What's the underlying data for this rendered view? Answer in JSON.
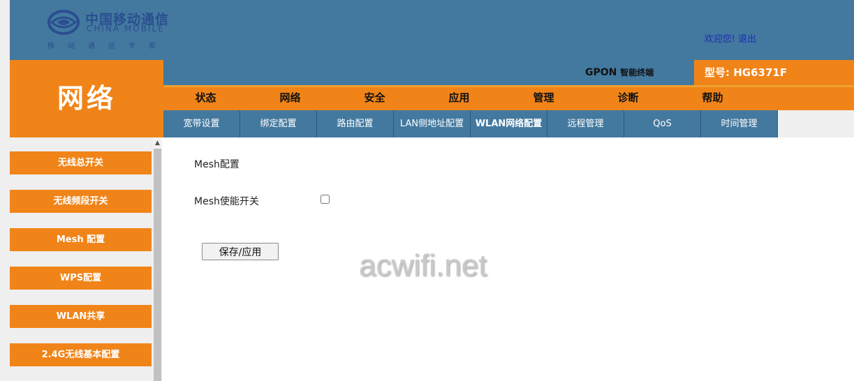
{
  "header": {
    "logo_cn": "中国移动通信",
    "logo_en": "CHINA MOBILE",
    "logo_slogan": "移动通信专家",
    "welcome_text": "欢迎您!",
    "logout_label": "退出"
  },
  "section_title": "网络",
  "device": {
    "gpon_label": "GPON",
    "terminal_label": "智能终端",
    "model_label": "型号: HG6371F"
  },
  "main_nav": [
    "状态",
    "网络",
    "安全",
    "应用",
    "管理",
    "诊断",
    "帮助"
  ],
  "sub_nav": [
    "宽带设置",
    "绑定配置",
    "路由配置",
    "LAN侧地址配置",
    "WLAN网络配置",
    "远程管理",
    "QoS",
    "时间管理"
  ],
  "sidebar": [
    "无线总开关",
    "无线频段开关",
    "Mesh 配置",
    "WPS配置",
    "WLAN共享",
    "2.4G无线基本配置"
  ],
  "content": {
    "title": "Mesh配置",
    "enable_label": "Mesh使能开关",
    "save_button": "保存/应用"
  },
  "watermark": "acwifi.net",
  "colors": {
    "header_blue": "#43799f",
    "accent_orange": "#f08418",
    "link_blue": "#1b2db8"
  }
}
